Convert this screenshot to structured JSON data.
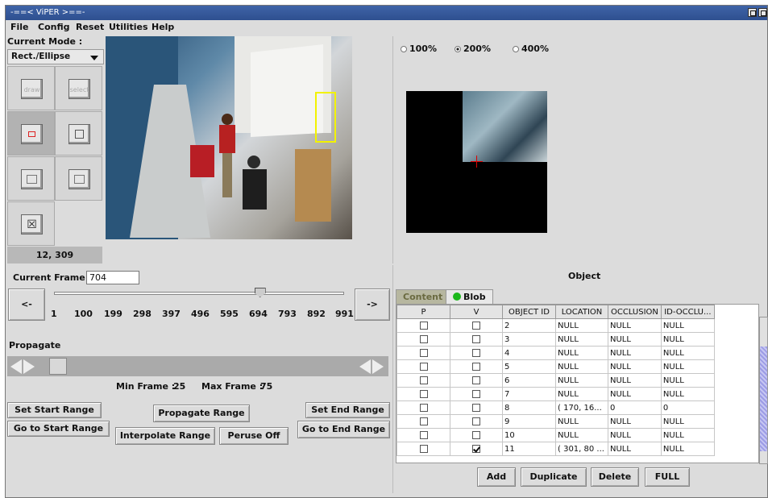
{
  "window": {
    "title": "-==< ViPER >==-"
  },
  "menu": [
    "File",
    "Config",
    "Reset",
    "Utilities",
    "Help"
  ],
  "mode": {
    "label": "Current Mode :",
    "value": "Rect./Ellipse"
  },
  "tools": {
    "draw": "draw",
    "select": "select"
  },
  "coords": "12, 309",
  "zoom": {
    "options": [
      "100%",
      "200%",
      "400%"
    ],
    "selected": "200%"
  },
  "frame": {
    "label": "Current Frame :",
    "value": "704",
    "prev": "<-",
    "next": "->",
    "ticks": [
      "1",
      "100",
      "199",
      "298",
      "397",
      "496",
      "595",
      "694",
      "793",
      "892",
      "991"
    ],
    "slider_value": 704,
    "slider_max": 991
  },
  "propagate": {
    "label": "Propagate",
    "min_label": "Min Frame :",
    "min_value": "25",
    "max_label": "Max Frame :",
    "max_value": "75"
  },
  "buttons": {
    "set_start": "Set Start Range",
    "go_start": "Go to Start Range",
    "propagate_range": "Propagate Range",
    "interpolate_range": "Interpolate Range",
    "peruse_off": "Peruse Off",
    "set_end": "Set End Range",
    "go_end": "Go to End Range"
  },
  "object": {
    "title": "Object",
    "tabs": [
      "Content",
      "Blob"
    ],
    "columns": [
      "P",
      "V",
      "OBJECT ID",
      "LOCATION",
      "OCCLUSION",
      "ID-OCCLU..."
    ],
    "rows": [
      {
        "p": false,
        "v": false,
        "id": "2",
        "location": "NULL",
        "occlusion": "NULL",
        "id_occlu": "NULL"
      },
      {
        "p": false,
        "v": false,
        "id": "3",
        "location": "NULL",
        "occlusion": "NULL",
        "id_occlu": "NULL"
      },
      {
        "p": false,
        "v": false,
        "id": "4",
        "location": "NULL",
        "occlusion": "NULL",
        "id_occlu": "NULL"
      },
      {
        "p": false,
        "v": false,
        "id": "5",
        "location": "NULL",
        "occlusion": "NULL",
        "id_occlu": "NULL"
      },
      {
        "p": false,
        "v": false,
        "id": "6",
        "location": "NULL",
        "occlusion": "NULL",
        "id_occlu": "NULL"
      },
      {
        "p": false,
        "v": false,
        "id": "7",
        "location": "NULL",
        "occlusion": "NULL",
        "id_occlu": "NULL"
      },
      {
        "p": false,
        "v": false,
        "id": "8",
        "location": "( 170, 16...",
        "occlusion": "0",
        "id_occlu": "0"
      },
      {
        "p": false,
        "v": false,
        "id": "9",
        "location": "NULL",
        "occlusion": "NULL",
        "id_occlu": "NULL"
      },
      {
        "p": false,
        "v": false,
        "id": "10",
        "location": "NULL",
        "occlusion": "NULL",
        "id_occlu": "NULL"
      },
      {
        "p": false,
        "v": true,
        "id": "11",
        "location": "( 301, 80 ...",
        "occlusion": "NULL",
        "id_occlu": "NULL"
      }
    ],
    "actions": [
      "Add",
      "Duplicate",
      "Delete",
      "FULL"
    ]
  }
}
